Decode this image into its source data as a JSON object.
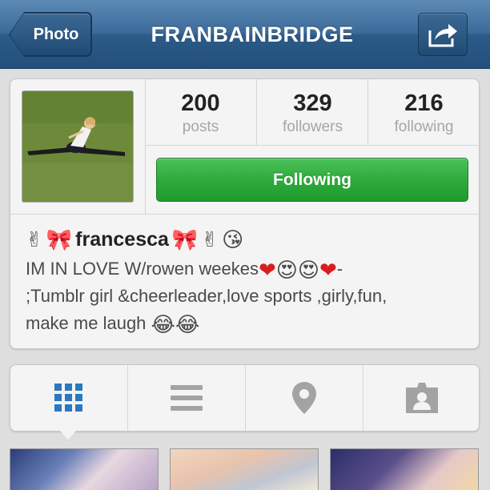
{
  "header": {
    "back_label": "Photo",
    "title": "FRANBAINBRIDGE",
    "share_icon": "share-icon"
  },
  "profile": {
    "stats": [
      {
        "value": "200",
        "label": "posts"
      },
      {
        "value": "329",
        "label": "followers"
      },
      {
        "value": "216",
        "label": "following"
      }
    ],
    "follow_button": "Following",
    "username": "francesca",
    "bio_line1": "IM IN LOVE W/rowen weekes",
    "bio_line1_end": "-",
    "bio_line2": ";Tumblr girl &cheerleader,love sports ,girly,fun,",
    "bio_line3": "make me laugh",
    "emoji": {
      "peace": "✌",
      "bow": "🎀",
      "kiss": "😘",
      "heart": "❤",
      "heart_eyes": "😍",
      "tears_of_joy": "😂"
    }
  },
  "tabs": [
    {
      "name": "grid-view",
      "icon": "grid-icon",
      "active": true
    },
    {
      "name": "list-view",
      "icon": "list-icon",
      "active": false
    },
    {
      "name": "map-view",
      "icon": "location-pin-icon",
      "active": false
    },
    {
      "name": "tagged-photos",
      "icon": "photo-of-you-icon",
      "active": false
    }
  ],
  "colors": {
    "navbar": "#3c6b9a",
    "follow_green": "#2faa3b",
    "active_tab_blue": "#2a78c2",
    "inactive_tab_gray": "#a3a3a3"
  }
}
